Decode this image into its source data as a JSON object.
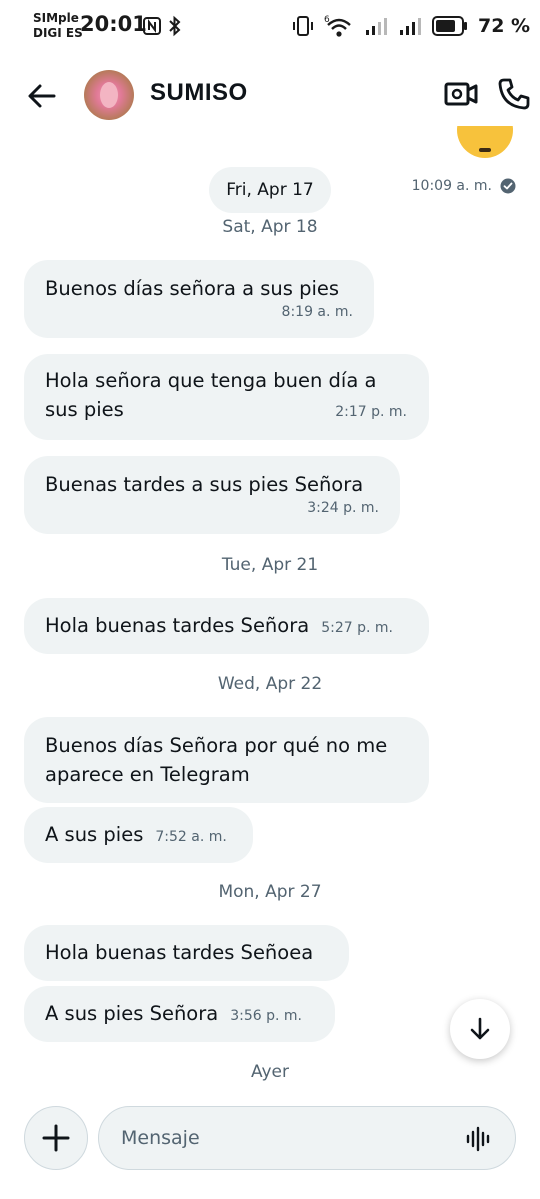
{
  "status_bar": {
    "carrier_line1": "SIMple",
    "carrier_line2": "DIGI ES",
    "time": "20:01",
    "battery_percent": "72 %",
    "icons": [
      "nfc-icon",
      "bluetooth-icon",
      "vibrate-icon",
      "wifi-6-icon",
      "signal-icon",
      "signal-icon",
      "battery-icon"
    ]
  },
  "header": {
    "contact_name": "SUMISO",
    "back_icon": "arrow-left-icon",
    "video_icon": "video-call-icon",
    "call_icon": "phone-icon"
  },
  "sent_message": {
    "time": "10:09 a. m.",
    "status_icon": "read-check-icon"
  },
  "date_chip": "Fri, Apr 17",
  "separators": {
    "sat_apr_18": "Sat, Apr 18",
    "tue_apr_21": "Tue, Apr 21",
    "wed_apr_22": "Wed, Apr 22",
    "mon_apr_27": "Mon, Apr 27",
    "ayer": "Ayer"
  },
  "messages": [
    {
      "text": "Buenos días señora a sus pies",
      "time": "8:19 a. m."
    },
    {
      "text": "Hola señora que tenga buen día a sus pies",
      "time": "2:17 p. m."
    },
    {
      "text": "Buenas tardes a sus pies Señora",
      "time": "3:24 p. m."
    },
    {
      "text": "Hola buenas tardes Señora",
      "time": "5:27 p. m."
    },
    {
      "text": "Buenos días Señora por qué no me aparece en Telegram",
      "time": ""
    },
    {
      "text": "A sus pies",
      "time": "7:52 a. m."
    },
    {
      "text": "Hola buenas tardes Señoea",
      "time": ""
    },
    {
      "text": "A sus pies Señora",
      "time": "3:56 p. m."
    }
  ],
  "composer": {
    "placeholder": "Mensaje",
    "add_icon": "plus-icon",
    "voice_icon": "voice-wave-icon"
  },
  "scroll_icon": "arrow-down-icon",
  "colors": {
    "bubble_bg": "#eff3f4",
    "secondary_text": "#536471",
    "primary_text": "#0f1419"
  }
}
